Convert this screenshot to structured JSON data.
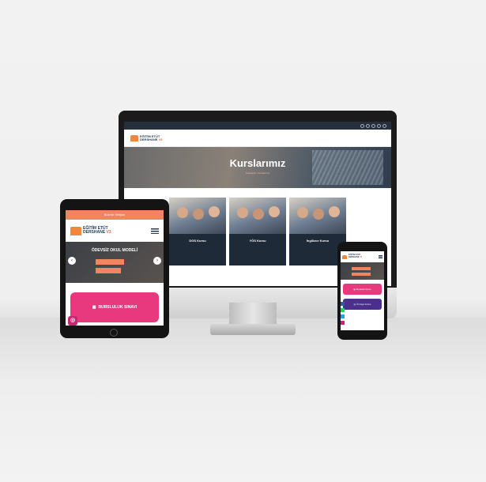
{
  "desktop": {
    "hero_title": "Kurslarımız",
    "breadcrumb": "Anasayfa / Kurslarımız",
    "cards": [
      {
        "title": "DGS Kursu"
      },
      {
        "title": "YÖS Kursu"
      },
      {
        "title": "İngilizce Kursu"
      }
    ]
  },
  "tablet": {
    "topbar": "Bizimle İletişim",
    "slider_title": "ÖDEVSİZ OKUL MODELİ",
    "pink_button": "BURSLULUK SINAVI"
  },
  "phone": {
    "button1": "Bursluluk Sınavı",
    "button2": "Ön Kayıt Formu"
  },
  "brand": {
    "name_line1": "EĞİTİM ETÜT",
    "name_line2": "DERSHANE",
    "version": "V3"
  },
  "colors": {
    "accent": "#f2855f",
    "pink": "#e8397f",
    "purple": "#4a2f8f",
    "navy": "#1e2a38"
  }
}
